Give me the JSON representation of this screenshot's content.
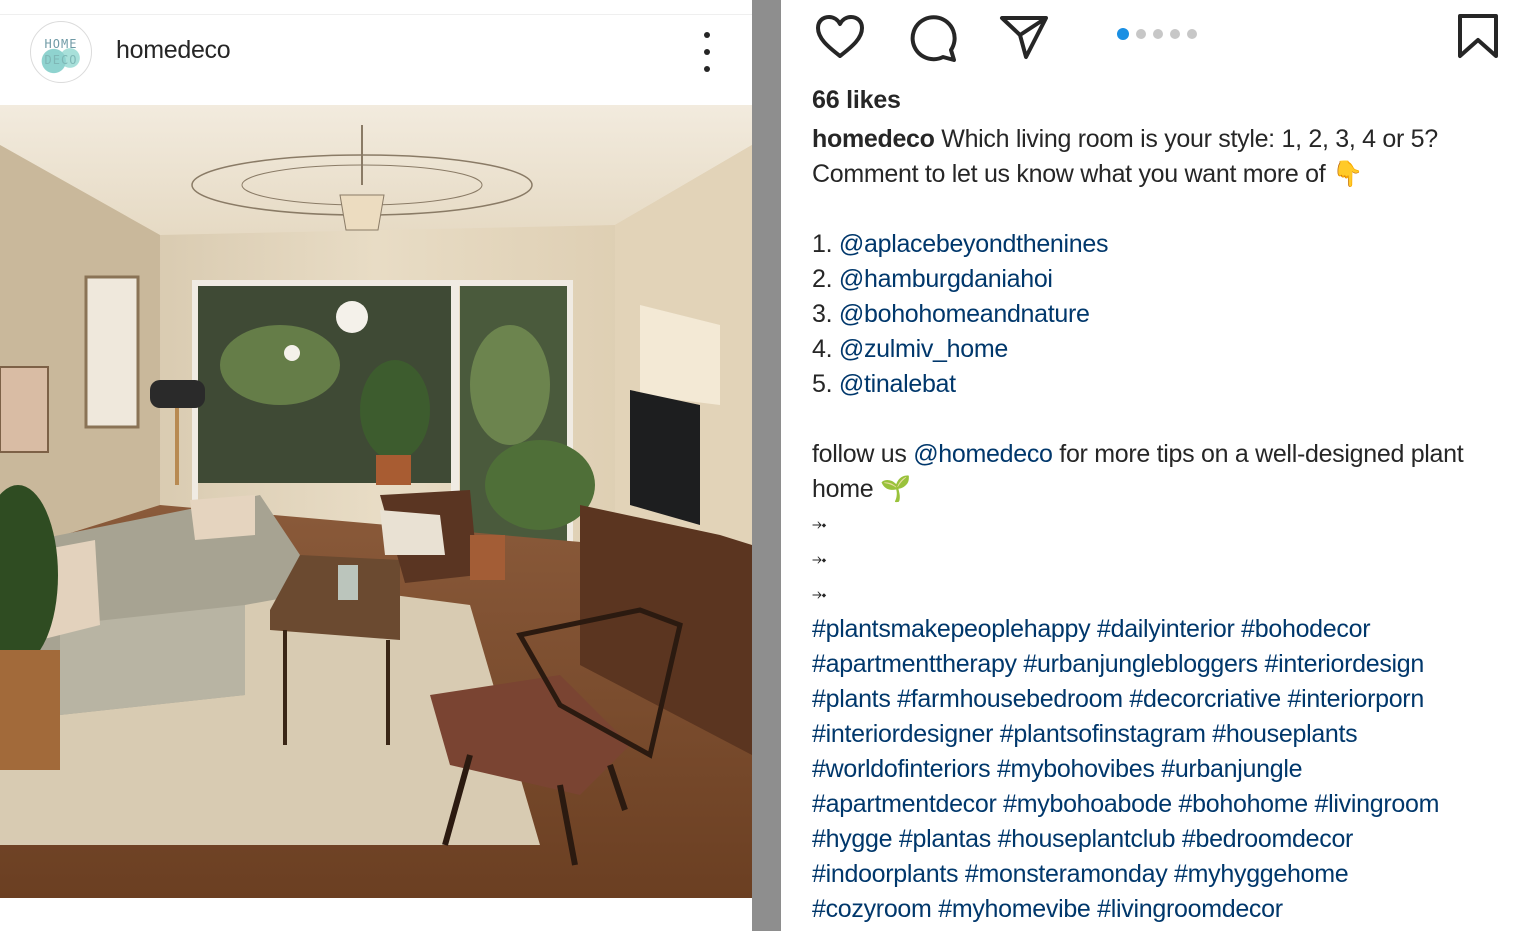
{
  "post": {
    "avatar_lines": [
      "HOME",
      "DECO"
    ],
    "username": "homedeco"
  },
  "actions": {
    "like_icon": "heart-icon",
    "comment_icon": "comment-icon",
    "share_icon": "send-icon",
    "save_icon": "bookmark-icon",
    "carousel_count": 5,
    "carousel_active": 0,
    "accent_color": "#1a8fe3"
  },
  "likes": "66 likes",
  "caption": {
    "username": "homedeco",
    "intro_1": " Which living room is your style: 1, 2, 3, 4 or 5?",
    "intro_2": "Comment to let us know what you want more of 👇",
    "list": [
      {
        "num": "1. ",
        "handle": "@aplacebeyondthenines"
      },
      {
        "num": "2. ",
        "handle": "@hamburgdaniahoi"
      },
      {
        "num": "3. ",
        "handle": "@bohohomeandnature"
      },
      {
        "num": "4. ",
        "handle": "@zulmiv_home"
      },
      {
        "num": "5. ",
        "handle": "@tinalebat"
      }
    ],
    "follow_pre": "follow us ",
    "follow_handle": "@homedeco",
    "follow_post": " for more tips on a well-designed plant",
    "follow_line2": "home 🌱",
    "arrows": [
      "⤞",
      "⤞",
      "⤞"
    ],
    "hashtag_lines": [
      "#plantsmakepeoplehappy #dailyinterior #bohodecor",
      "#apartmenttherapy #urbanjunglebloggers #interiordesign",
      "#plants #farmhousebedroom #decorcriative #interiorporn",
      "#interiordesigner #plantsofinstagram #houseplants",
      "#worldofinteriors #mybohovibes #urbanjungle",
      "#apartmentdecor #mybohoabode #bohohome #livingroom",
      "#hygge #plantas #houseplantclub #bedroomdecor",
      "#indoorplants #monsteramonday #myhyggehome",
      "#cozyroom #myhomevibe #livingroomdecor"
    ]
  }
}
